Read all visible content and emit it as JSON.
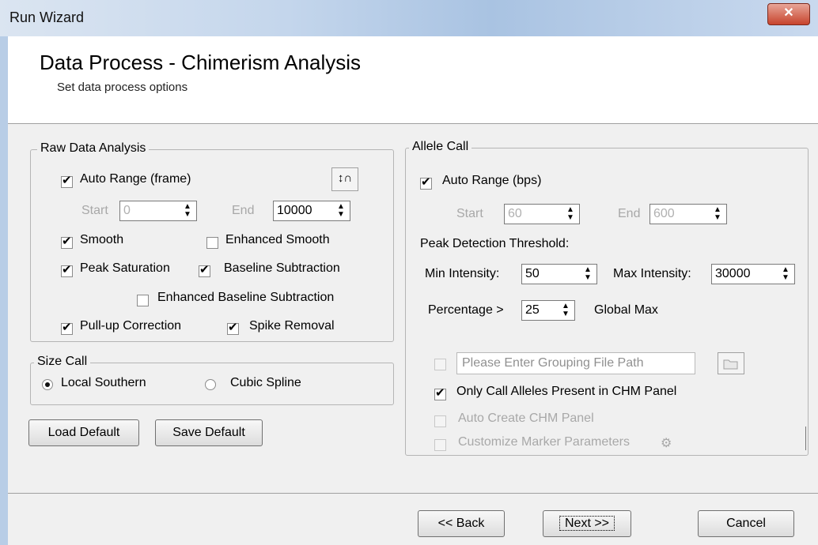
{
  "window": {
    "title": "Run Wizard",
    "close_glyph": "✕"
  },
  "header": {
    "title": "Data Process - Chimerism Analysis",
    "subtitle": "Set data process options"
  },
  "raw": {
    "legend": "Raw Data Analysis",
    "auto_range": {
      "label": "Auto Range (frame)",
      "checked": true
    },
    "start_label": "Start",
    "start_value": "0",
    "end_label": "End",
    "end_value": "10000",
    "smooth": {
      "label": "Smooth",
      "checked": true
    },
    "enhanced_smooth": {
      "label": "Enhanced Smooth",
      "checked": false
    },
    "peak_saturation": {
      "label": "Peak Saturation",
      "checked": true
    },
    "baseline_subtraction": {
      "label": "Baseline Subtraction",
      "checked": true
    },
    "enhanced_baseline": {
      "label": "Enhanced Baseline Subtraction",
      "checked": false
    },
    "pullup": {
      "label": "Pull-up Correction",
      "checked": true
    },
    "spike": {
      "label": "Spike Removal",
      "checked": true
    },
    "chart_icon_glyph": "↕∩"
  },
  "size": {
    "legend": "Size Call",
    "local_southern": {
      "label": "Local Southern",
      "selected": true
    },
    "cubic_spline": {
      "label": "Cubic Spline",
      "selected": false
    }
  },
  "buttons": {
    "load_default": "Load Default",
    "save_default": "Save Default",
    "back": "<< Back",
    "next": "Next >>",
    "cancel": "Cancel"
  },
  "allele": {
    "legend": "Allele Call",
    "auto_range": {
      "label": "Auto Range (bps)",
      "checked": true
    },
    "start_label": "Start",
    "start_value": "60",
    "end_label": "End",
    "end_value": "600",
    "peak_threshold_label": "Peak Detection Threshold:",
    "min_label": "Min Intensity:",
    "min_value": "50",
    "max_label": "Max Intensity:",
    "max_value": "30000",
    "pct_label": "Percentage >",
    "pct_value": "25",
    "global_max_label": "Global Max",
    "grouping_placeholder": "Please Enter Grouping File Path",
    "only_call": {
      "label": "Only Call Alleles Present in CHM Panel",
      "checked": true
    },
    "auto_create": {
      "label": "Auto Create CHM Panel",
      "checked": false
    },
    "customize": {
      "label": "Customize Marker Parameters",
      "checked": false
    }
  },
  "icons": {
    "spin": "spin-arrows-icon",
    "folder": "folder-icon",
    "settings": "settings-icon"
  }
}
